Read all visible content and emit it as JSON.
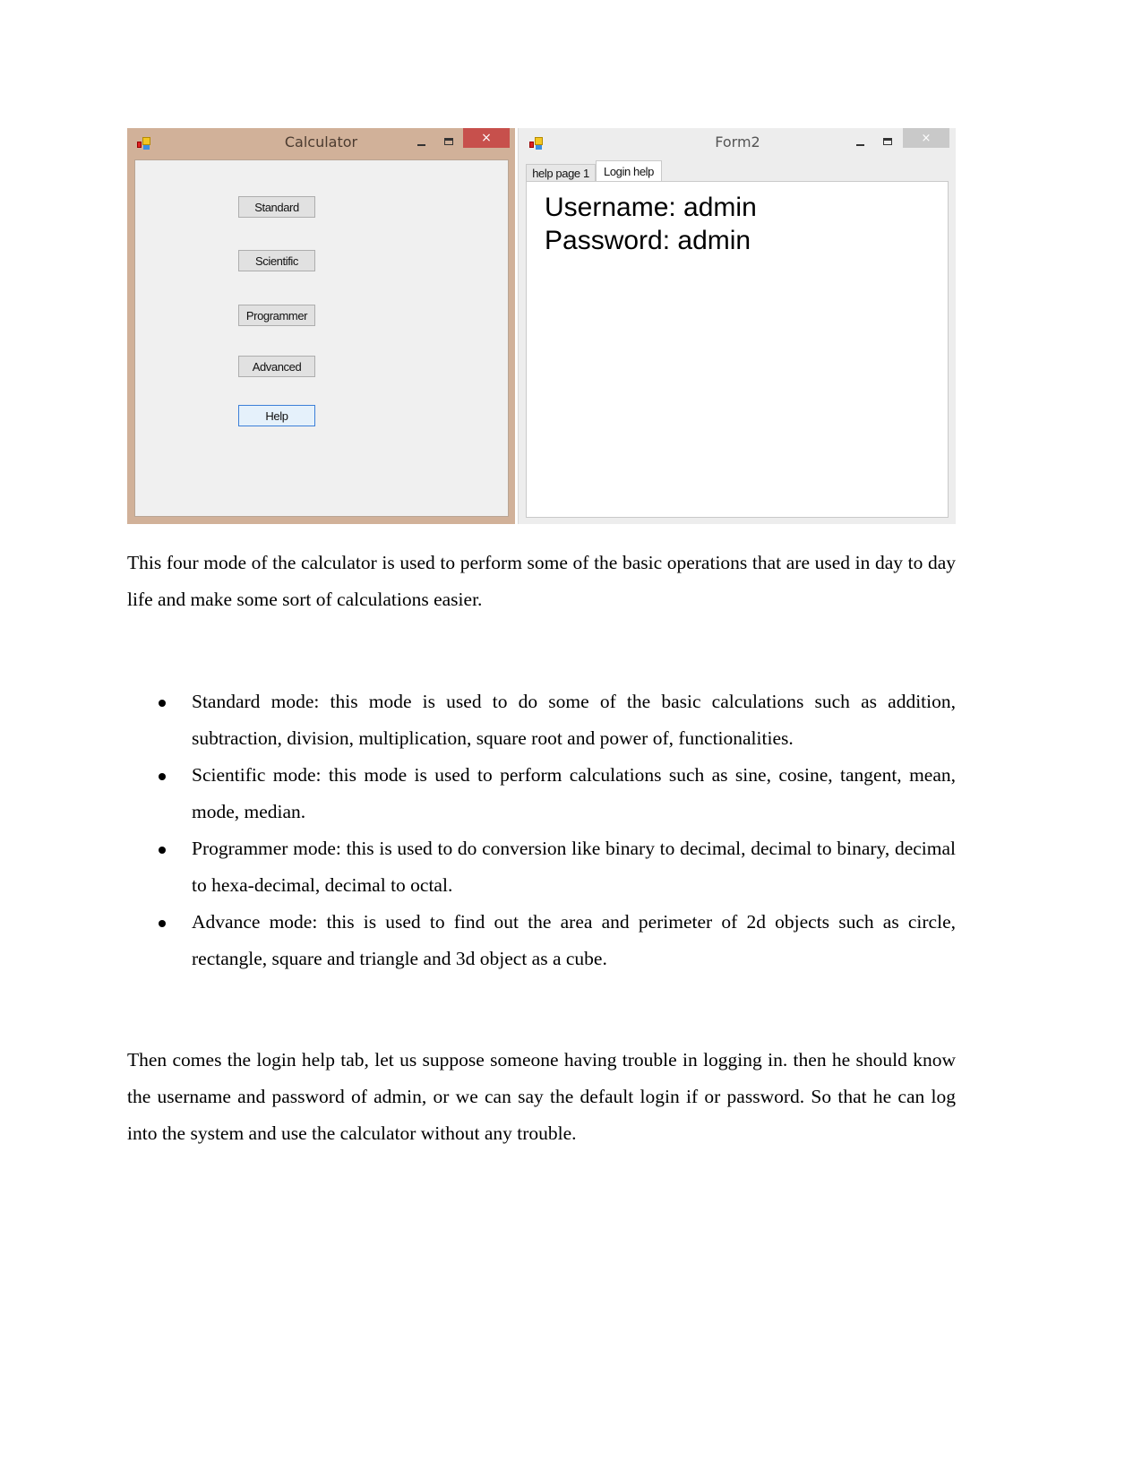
{
  "figure": {
    "calculator_window": {
      "title": "Calculator",
      "icon": "winforms-app-icon",
      "controls": {
        "minimize": "minimize-icon",
        "maximize": "maximize-icon",
        "close": "×"
      },
      "buttons": [
        {
          "label": "Standard",
          "focused": false
        },
        {
          "label": "Scientific",
          "focused": false
        },
        {
          "label": "Programmer",
          "focused": false
        },
        {
          "label": "Advanced",
          "focused": false
        },
        {
          "label": "Help",
          "focused": true
        }
      ],
      "frame_color": "#d1b199",
      "close_color": "#c7504c"
    },
    "form2_window": {
      "title": "Form2",
      "icon": "winforms-app-icon",
      "controls": {
        "minimize": "minimize-icon",
        "maximize": "maximize-icon",
        "close": "×"
      },
      "tabs": [
        {
          "label": "help page 1",
          "selected": false
        },
        {
          "label": "Login help",
          "selected": true
        }
      ],
      "content": {
        "username_line": "Username: admin",
        "password_line": "Password: admin"
      }
    }
  },
  "document": {
    "intro_paragraph": "This four mode of the calculator is used to perform some of the basic operations that are used in day to day life and make some sort of calculations easier.",
    "bullets": [
      "Standard mode: this mode is used to do some of the basic calculations such as addition, subtraction, division, multiplication, square root and power of, functionalities.",
      "Scientific mode: this mode is used to perform calculations such as sine, cosine, tangent, mean, mode, median.",
      "Programmer mode: this is used to do conversion like binary to decimal, decimal to binary, decimal to hexa-decimal, decimal to octal.",
      "Advance mode: this is used to find out the area and perimeter of 2d objects such as circle, rectangle, square and triangle and 3d object as a cube."
    ],
    "closing_paragraph": "Then comes the login help tab, let us suppose someone having trouble in logging in. then he should know the username and password of admin, or we can say the default login if or password. So that he can log into the system and use the calculator without any trouble."
  }
}
